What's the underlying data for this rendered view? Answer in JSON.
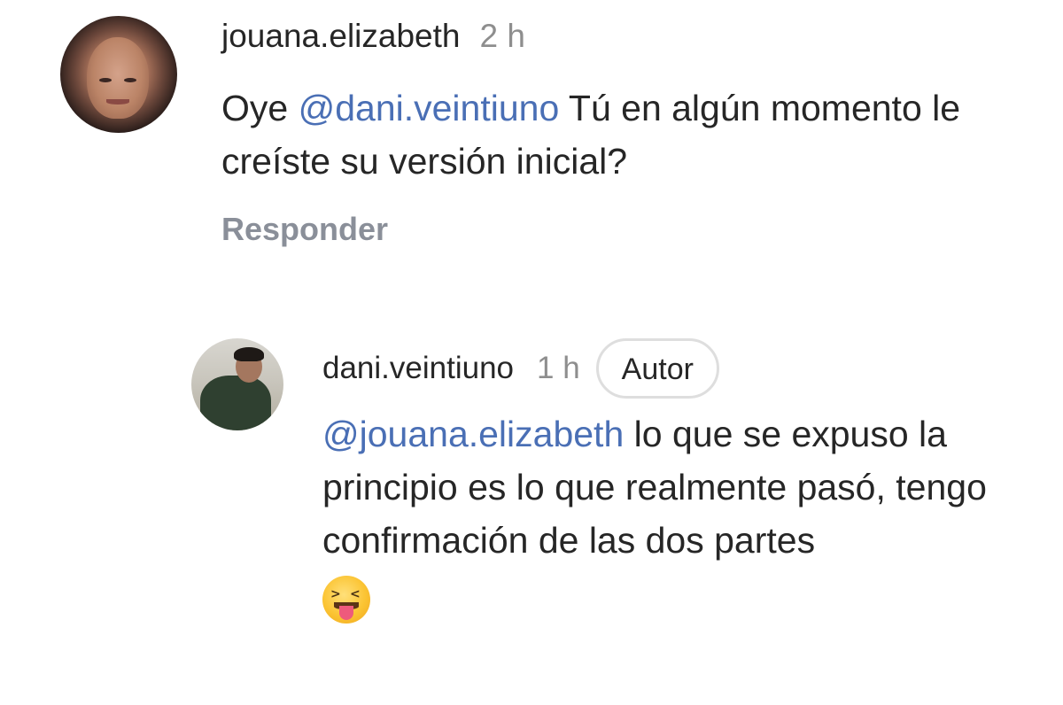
{
  "comments": [
    {
      "username": "jouana.elizabeth",
      "time": "2 h",
      "text_prefix": "Oye ",
      "mention": "@dani.veintiuno",
      "text_suffix": " Tú en algún momento le creíste su versión inicial?",
      "reply_label": "Responder"
    },
    {
      "username": "dani.veintiuno",
      "time": "1 h",
      "badge": "Autor",
      "mention": "@jouana.elizabeth",
      "text_suffix": " lo que se expuso la principio es lo que realmente pasó, tengo confirmación de las dos partes",
      "emoji": "squinting-face-with-tongue"
    }
  ],
  "colors": {
    "mention": "#4a6fb5",
    "timestamp": "#8e8e8e",
    "reply": "#8a8f99",
    "badge_border": "#dedede"
  }
}
